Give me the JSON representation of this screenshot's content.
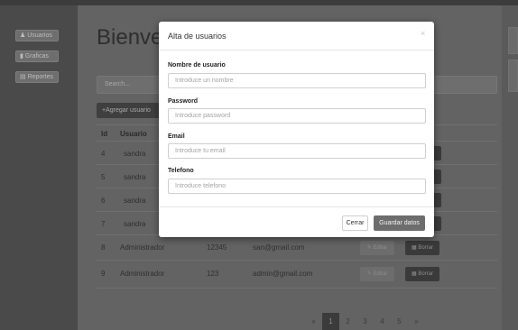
{
  "sidebar": {
    "items": [
      {
        "icon": "user-icon",
        "label": "Usuarios"
      },
      {
        "icon": "bar-chart-icon",
        "label": "Graficas"
      },
      {
        "icon": "report-icon",
        "label": "Reportes"
      }
    ]
  },
  "main": {
    "heading": "Bienveni",
    "search_placeholder": "Search...",
    "add_button": "Agregar usuario",
    "table": {
      "headers": [
        "Id",
        "Usuario"
      ],
      "rows": [
        {
          "id": "4",
          "usuario": "sandra",
          "password": "",
          "email": ""
        },
        {
          "id": "5",
          "usuario": "sandra",
          "password": "",
          "email": ""
        },
        {
          "id": "6",
          "usuario": "sandra",
          "password": "",
          "email": ""
        },
        {
          "id": "7",
          "usuario": "sandra",
          "password": "",
          "email": ""
        },
        {
          "id": "8",
          "usuario": "Administrador",
          "password": "12345",
          "email": "san@gmail.com"
        },
        {
          "id": "9",
          "usuario": "Administrador",
          "password": "123",
          "email": "admin@gmail.com"
        }
      ],
      "edit_label": "Editar",
      "delete_label": "Borrar"
    },
    "pagination": {
      "prev": "«",
      "pages": [
        "1",
        "2",
        "3",
        "4",
        "5"
      ],
      "next": "»",
      "active": "1"
    }
  },
  "modal": {
    "title": "Alta de usuarios",
    "close": "×",
    "fields": [
      {
        "label": "Nombre de usuario",
        "placeholder": "Introduce un nombre"
      },
      {
        "label": "Password",
        "placeholder": "Introduce password"
      },
      {
        "label": "Email",
        "placeholder": "Introduce tu email"
      },
      {
        "label": "Telefono",
        "placeholder": "Introduce telefono"
      }
    ],
    "close_button": "Cerrar",
    "save_button": "Guardar datos"
  }
}
